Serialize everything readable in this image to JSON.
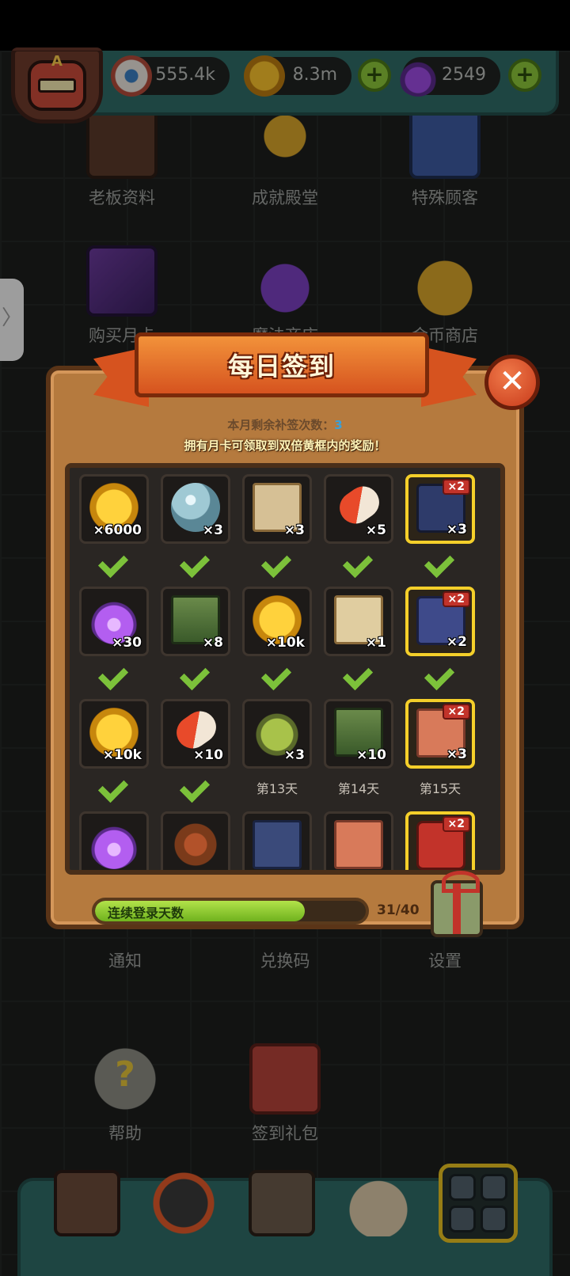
{
  "resources": {
    "eyes": "555.4k",
    "coins": "8.3m",
    "potions": "2549",
    "avatar_letter": "A"
  },
  "menu": {
    "row1": [
      "老板资料",
      "成就殿堂",
      "特殊顾客"
    ],
    "row2": [
      "购买月卡",
      "魔法商店",
      "金币商店"
    ],
    "row3": [
      "通知",
      "兑换码",
      "设置"
    ],
    "row4": [
      "帮助",
      "签到礼包"
    ]
  },
  "dialog": {
    "title": "每日签到",
    "remaining_label": "本月剩余补签次数：",
    "remaining_count": "3",
    "notice": "拥有月卡可领取到双倍黄框内的奖励！",
    "close": "✕",
    "double_badge": "×2",
    "progress_label": "连续登录天数",
    "progress_count": "31/40",
    "progress_value": 0.775
  },
  "rewards": [
    {
      "art": "coin",
      "qty": "×6000",
      "claimed": true,
      "gold": false
    },
    {
      "art": "orb",
      "qty": "×3",
      "claimed": true,
      "gold": false
    },
    {
      "art": "map",
      "qty": "×3",
      "claimed": true,
      "gold": false
    },
    {
      "art": "capsule",
      "qty": "×5",
      "claimed": true,
      "gold": false
    },
    {
      "art": "monster",
      "qty": "×3",
      "claimed": true,
      "gold": true
    },
    {
      "art": "potion",
      "qty": "×30",
      "claimed": true,
      "gold": false
    },
    {
      "art": "ticket",
      "qty": "×8",
      "claimed": true,
      "gold": false
    },
    {
      "art": "coin",
      "qty": "×10k",
      "claimed": true,
      "gold": false
    },
    {
      "art": "scroll",
      "qty": "×1",
      "claimed": true,
      "gold": false
    },
    {
      "art": "cauldron",
      "qty": "×2",
      "claimed": true,
      "gold": true
    },
    {
      "art": "coin",
      "qty": "×10k",
      "claimed": true,
      "gold": false
    },
    {
      "art": "capsule",
      "qty": "×10",
      "claimed": true,
      "gold": false
    },
    {
      "art": "green",
      "qty": "×3",
      "claimed": false,
      "gold": false,
      "day": "第13天"
    },
    {
      "art": "ticket",
      "qty": "×10",
      "claimed": false,
      "gold": false,
      "day": "第14天"
    },
    {
      "art": "carpet",
      "qty": "×3",
      "claimed": false,
      "gold": true,
      "day": "第15天"
    },
    {
      "art": "potion",
      "qty": "",
      "claimed": false,
      "gold": false
    },
    {
      "art": "leaf",
      "qty": "",
      "claimed": false,
      "gold": false
    },
    {
      "art": "book2",
      "qty": "",
      "claimed": false,
      "gold": false
    },
    {
      "art": "carpet",
      "qty": "",
      "claimed": false,
      "gold": false
    },
    {
      "art": "red",
      "qty": "",
      "claimed": false,
      "gold": true
    }
  ]
}
